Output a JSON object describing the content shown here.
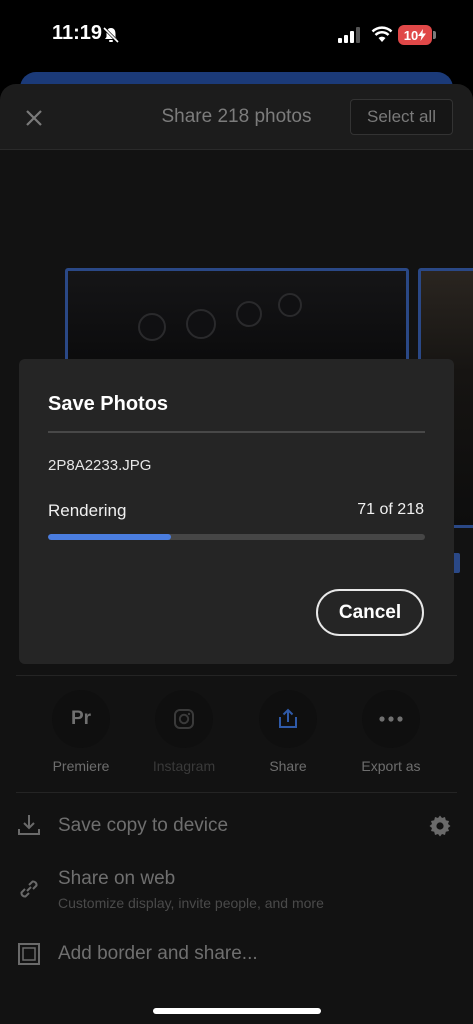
{
  "status_bar": {
    "time": "11:19",
    "battery": "10"
  },
  "sheet": {
    "title": "Share 218 photos",
    "select_all_label": "Select all"
  },
  "actions": [
    {
      "label": "Premiere",
      "icon": "premiere-icon",
      "badge": "Pr"
    },
    {
      "label": "Instagram",
      "icon": "instagram-icon"
    },
    {
      "label": "Share",
      "icon": "share-icon"
    },
    {
      "label": "Export as",
      "icon": "more-icon"
    }
  ],
  "options": {
    "save_copy": "Save copy to device",
    "share_web": "Share on web",
    "share_web_sub": "Customize display, invite people, and more",
    "add_border": "Add border and share..."
  },
  "modal": {
    "title": "Save Photos",
    "file_name": "2P8A2233.JPG",
    "status": "Rendering",
    "count": "71 of 218",
    "progress": 0.326,
    "cancel_label": "Cancel"
  },
  "colors": {
    "accent": "#4a7de0",
    "battery_low": "#e04848"
  }
}
